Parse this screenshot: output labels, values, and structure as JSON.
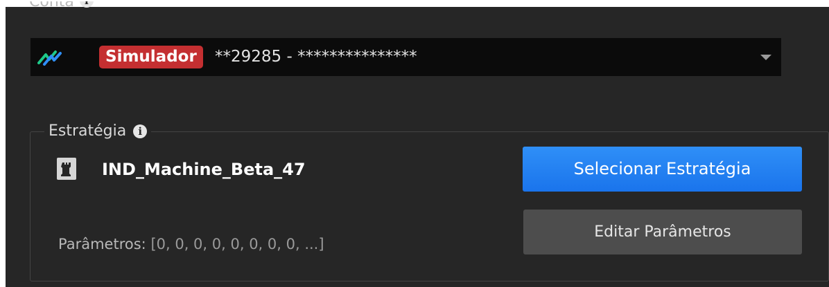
{
  "account_section": {
    "label": "Conta",
    "info_icon": "info-icon",
    "selected": {
      "logo_icon": "lightning-logo-icon",
      "badge": "Simulador",
      "badge_color": "#c42f31",
      "account": "**29285 - ***************"
    },
    "dropdown_icon": "chevron-down-icon"
  },
  "strategy_section": {
    "label": "Estratégia",
    "info_icon": "info-icon",
    "strategy_icon": "rook-icon",
    "strategy_name": "IND_Machine_Beta_47",
    "params_label": "Parâmetros:",
    "params_value": "[0, 0, 0, 0, 0, 0, 0, 0, ...]",
    "select_button": "Selecionar Estratégia",
    "select_button_color": "#1f7ff0",
    "edit_button": "Editar Parâmetros"
  }
}
